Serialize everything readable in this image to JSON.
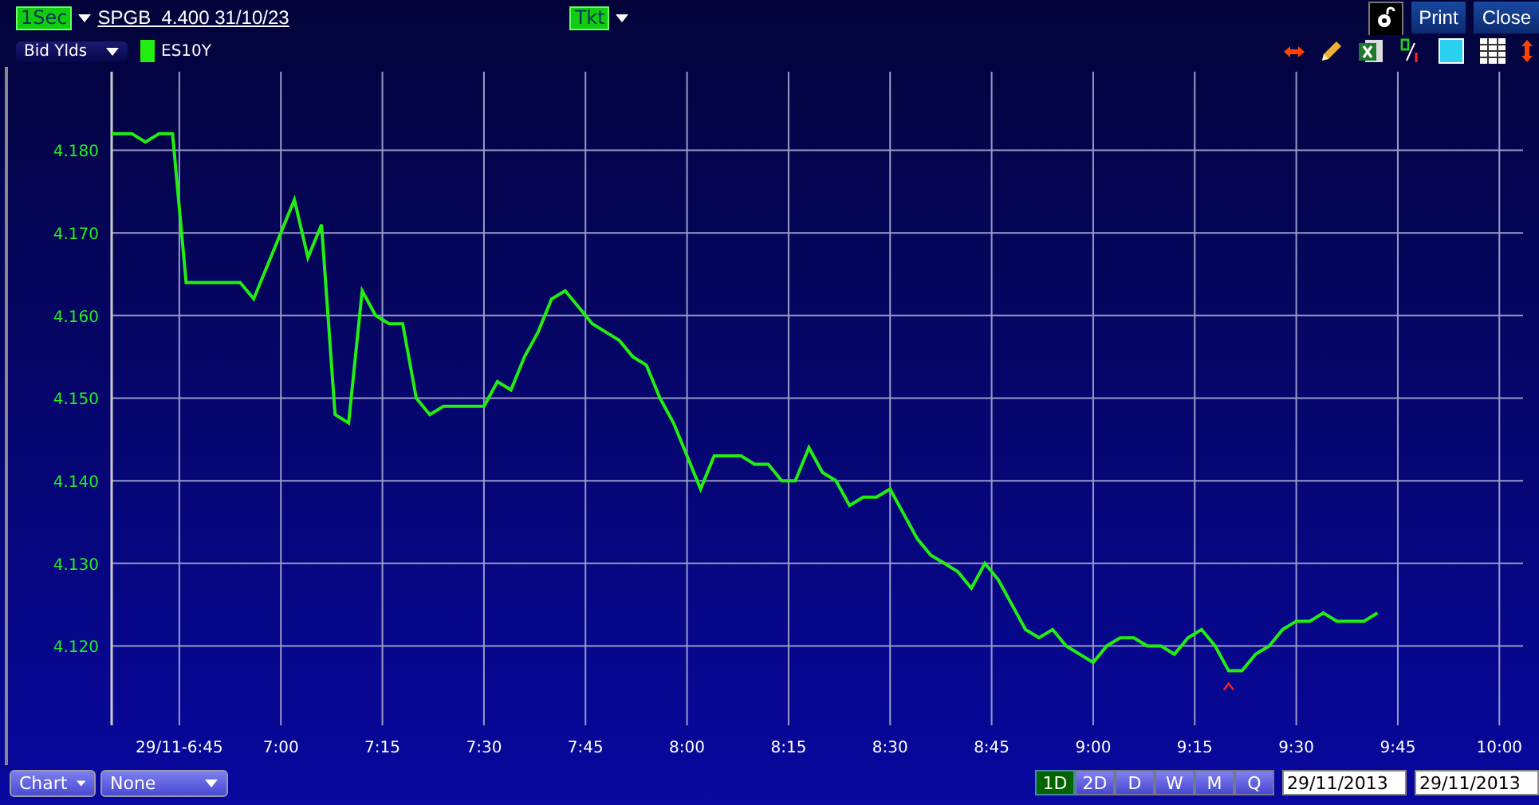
{
  "toolbar": {
    "interval": "1Sec",
    "instrument": "SPGB  4.400 31/10/23",
    "ticket": "Tkt",
    "buttons": [
      "Print",
      "Close"
    ]
  },
  "series_selector": {
    "value": "Bid Ylds"
  },
  "chart_data": {
    "type": "line",
    "x": [
      395,
      398,
      400,
      402,
      404,
      406,
      414,
      416,
      422,
      424,
      426,
      428,
      430,
      432,
      434,
      436,
      438,
      440,
      442,
      444,
      450,
      452,
      454,
      456,
      458,
      460,
      462,
      466,
      470,
      472,
      474,
      476,
      478,
      480,
      482,
      484,
      488,
      490,
      492,
      494,
      496,
      498,
      500,
      502,
      504,
      506,
      508,
      510,
      512,
      514,
      516,
      518,
      520,
      522,
      524,
      526,
      528,
      530,
      532,
      534,
      536,
      540,
      542,
      544,
      546,
      548,
      550,
      552,
      554,
      556,
      558,
      560,
      562,
      564,
      566,
      568,
      570,
      572,
      574,
      576,
      580,
      582
    ],
    "series": [
      {
        "name": "ES10Y",
        "color": "#22ee11",
        "values": [
          4.182,
          4.182,
          4.181,
          4.182,
          4.182,
          4.164,
          4.164,
          4.162,
          4.174,
          4.167,
          4.171,
          4.148,
          4.147,
          4.163,
          4.16,
          4.159,
          4.159,
          4.15,
          4.148,
          4.149,
          4.149,
          4.152,
          4.151,
          4.155,
          4.158,
          4.162,
          4.163,
          4.159,
          4.157,
          4.155,
          4.154,
          4.15,
          4.147,
          4.143,
          4.139,
          4.143,
          4.143,
          4.142,
          4.142,
          4.14,
          4.14,
          4.144,
          4.141,
          4.14,
          4.137,
          4.138,
          4.138,
          4.139,
          4.136,
          4.133,
          4.131,
          4.13,
          4.129,
          4.127,
          4.13,
          4.128,
          4.125,
          4.122,
          4.121,
          4.122,
          4.12,
          4.118,
          4.12,
          4.121,
          4.121,
          4.12,
          4.12,
          4.119,
          4.121,
          4.122,
          4.12,
          4.117,
          4.117,
          4.119,
          4.12,
          4.122,
          4.123,
          4.123,
          4.124,
          4.123,
          4.123,
          4.124
        ]
      }
    ],
    "grid": true,
    "xlim": [
      395,
      603.5
    ],
    "ylim": [
      4.1104,
      4.1895
    ],
    "xticks": [
      {
        "value": 405,
        "label": "29/11-6:45"
      },
      {
        "value": 420,
        "label": "7:00"
      },
      {
        "value": 435,
        "label": "7:15"
      },
      {
        "value": 450,
        "label": "7:30"
      },
      {
        "value": 465,
        "label": "7:45"
      },
      {
        "value": 480,
        "label": "8:00"
      },
      {
        "value": 495,
        "label": "8:15"
      },
      {
        "value": 510,
        "label": "8:30"
      },
      {
        "value": 525,
        "label": "8:45"
      },
      {
        "value": 540,
        "label": "9:00"
      },
      {
        "value": 555,
        "label": "9:15"
      },
      {
        "value": 570,
        "label": "9:30"
      },
      {
        "value": 585,
        "label": "9:45"
      },
      {
        "value": 600,
        "label": "10:00"
      }
    ],
    "yticks": [
      {
        "value": 4.12,
        "label": "4.120"
      },
      {
        "value": 4.13,
        "label": "4.130"
      },
      {
        "value": 4.14,
        "label": "4.140"
      },
      {
        "value": 4.15,
        "label": "4.150"
      },
      {
        "value": 4.16,
        "label": "4.160"
      },
      {
        "value": 4.17,
        "label": "4.170"
      },
      {
        "value": 4.18,
        "label": "4.180"
      }
    ]
  },
  "bottom": {
    "chart_type": "Chart",
    "overlay": "None",
    "periods": [
      {
        "label": "1D",
        "selected": true
      },
      {
        "label": "2D",
        "selected": false
      },
      {
        "label": "D",
        "selected": false
      },
      {
        "label": "W",
        "selected": false
      },
      {
        "label": "M",
        "selected": false
      },
      {
        "label": "Q",
        "selected": false
      }
    ],
    "date_from": "29/11/2013",
    "date_to": "29/11/2013"
  }
}
